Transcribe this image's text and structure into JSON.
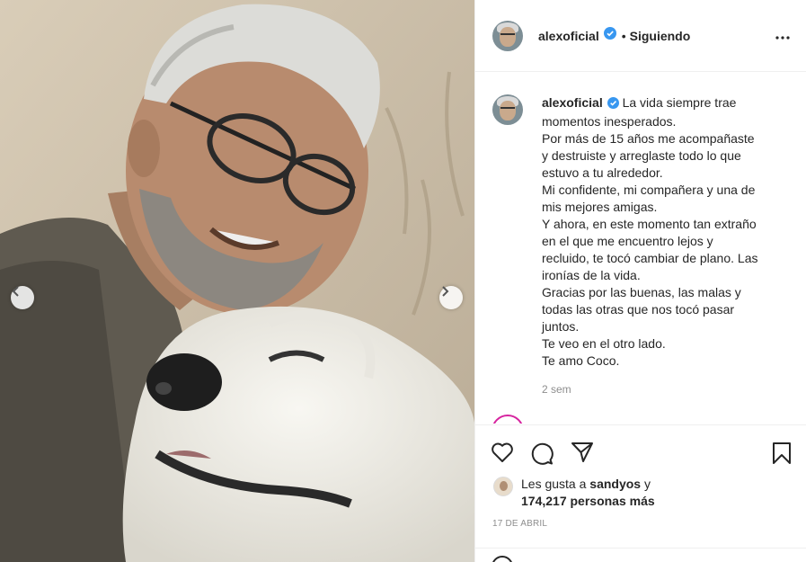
{
  "post": {
    "username": "alexoficial",
    "separator": "•",
    "follow_status": "Siguiendo",
    "more_label": "Más opciones"
  },
  "caption": {
    "username": "alexoficial",
    "lines": [
      "La vida siempre trae",
      "momentos inesperados.",
      "Por más de 15 años me acompañaste",
      "y destruiste y arreglaste todo lo que",
      "estuvo a tu alrededor.",
      "Mi confidente, mi compañera y una de",
      "mis mejores amigas.",
      "Y ahora, en este momento tan extraño",
      "en el que me encuentro lejos y",
      "recluido, te tocó cambiar de plano. Las",
      "ironías de la vida.",
      "Gracias por las buenas, las malas y",
      "todas las otras que nos tocó pasar",
      "juntos.",
      "Te veo en el otro lado.",
      "Te amo Coco."
    ],
    "time_ago": "2 sem"
  },
  "likes": {
    "prefix": "Les gusta a",
    "first_liker": "sandyos",
    "connector": "y",
    "count_text": "174,217 personas más"
  },
  "date": "17 DE ABRIL",
  "icons": {
    "like": "heart-icon",
    "comment": "comment-bubble-icon",
    "share": "paper-plane-icon",
    "save": "bookmark-icon",
    "verified": "verified-badge-icon",
    "more": "more-dots-icon",
    "prev": "chevron-left-icon",
    "next": "chevron-right-icon"
  },
  "colors": {
    "verified": "#3897f0",
    "text": "#262626",
    "muted": "#8e8e8e",
    "border": "#efefef"
  }
}
